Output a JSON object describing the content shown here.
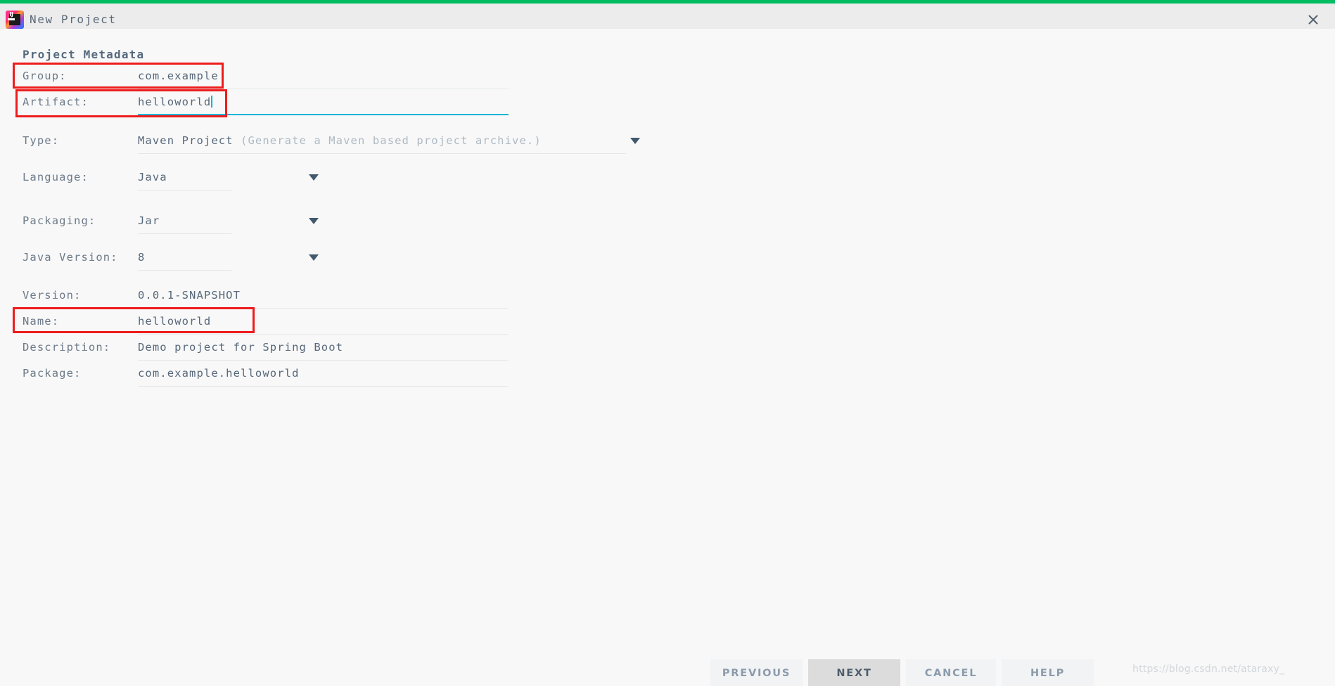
{
  "window": {
    "title": "New Project",
    "app_icon": "intellij-idea-logo",
    "close_icon": "close-icon",
    "accent_color": "#00bd62",
    "titlebar_color": "#ececec",
    "body_color": "#f8f8f8"
  },
  "form": {
    "section_title": "Project Metadata",
    "focus_color": "#00b4d8",
    "annotation_color": "#ee1c1c",
    "rows": [
      {
        "label": "Group:",
        "value": "com.example",
        "hint": "",
        "type": "text",
        "focused": false,
        "annotated": true
      },
      {
        "label": "Artifact:",
        "value": "helloworld",
        "hint": "",
        "type": "text",
        "focused": true,
        "annotated": true
      },
      {
        "label": "Type:",
        "value": "Maven Project",
        "hint": "(Generate a Maven based project archive.)",
        "type": "dropdown",
        "focused": false,
        "annotated": false
      },
      {
        "label": "Language:",
        "value": "Java",
        "hint": "",
        "type": "dropdown",
        "focused": false,
        "annotated": false
      },
      {
        "label": "Packaging:",
        "value": "Jar",
        "hint": "",
        "type": "dropdown",
        "focused": false,
        "annotated": false
      },
      {
        "label": "Java Version:",
        "value": "8",
        "hint": "",
        "type": "dropdown",
        "focused": false,
        "annotated": false
      },
      {
        "label": "Version:",
        "value": "0.0.1-SNAPSHOT",
        "hint": "",
        "type": "text",
        "focused": false,
        "annotated": false
      },
      {
        "label": "Name:",
        "value": "helloworld",
        "hint": "",
        "type": "text",
        "focused": false,
        "annotated": true
      },
      {
        "label": "Description:",
        "value": "Demo project for Spring Boot",
        "hint": "",
        "type": "text",
        "focused": false,
        "annotated": false
      },
      {
        "label": "Package:",
        "value": "com.example.helloworld",
        "hint": "",
        "type": "text",
        "focused": false,
        "annotated": false
      }
    ]
  },
  "buttons": {
    "previous": "PREVIOUS",
    "next": "NEXT",
    "cancel": "CANCEL",
    "help": "HELP"
  },
  "watermark": "https://blog.csdn.net/ataraxy_"
}
